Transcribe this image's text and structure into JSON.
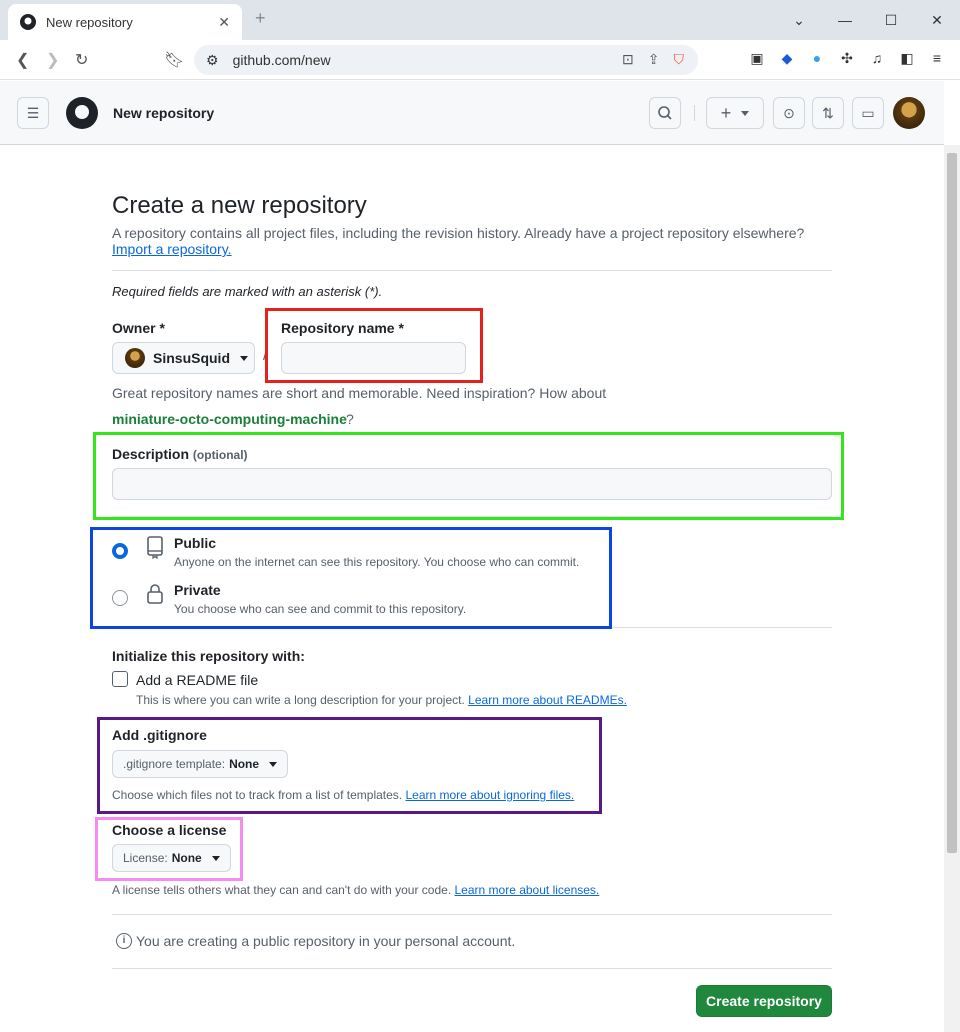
{
  "browser": {
    "tab_title": "New repository",
    "url": "github.com/new"
  },
  "header": {
    "title": "New repository",
    "new_button_label": "+"
  },
  "page": {
    "heading": "Create a new repository",
    "lede": "A repository contains all project files, including the revision history. Already have a project repository elsewhere?",
    "import_link": "Import a repository.",
    "required_note": "Required fields are marked with an asterisk (*)."
  },
  "owner": {
    "label": "Owner *",
    "value": "SinsuSquid"
  },
  "separator": "/",
  "repo_name": {
    "label": "Repository name *",
    "value": ""
  },
  "name_hint": "Great repository names are short and memorable. Need inspiration? How about",
  "suggestion": "miniature-octo-computing-machine",
  "suggestion_q": "?",
  "description": {
    "label": "Description",
    "optional": "(optional)",
    "value": ""
  },
  "visibility": {
    "public_title": "Public",
    "public_desc": "Anyone on the internet can see this repository. You choose who can commit.",
    "private_title": "Private",
    "private_desc": "You choose who can see and commit to this repository.",
    "selected": "public"
  },
  "init": {
    "heading": "Initialize this repository with:",
    "readme_label": "Add a README file",
    "readme_desc": "This is where you can write a long description for your project.",
    "readme_link": "Learn more about READMEs.",
    "readme_checked": false
  },
  "gitignore": {
    "heading": "Add .gitignore",
    "select_key": ".gitignore template:",
    "select_value": "None",
    "desc": "Choose which files not to track from a list of templates.",
    "link": "Learn more about ignoring files."
  },
  "license": {
    "heading": "Choose a license",
    "select_key": "License:",
    "select_value": "None",
    "desc": "A license tells others what they can and can't do with your code.",
    "link": "Learn more about licenses."
  },
  "notice": "You are creating a public repository in your personal account.",
  "submit_label": "Create repository",
  "annotation_colors": {
    "red": "#e8201c",
    "green": "#33e51a",
    "blue": "#0a47e0",
    "purple": "#5a1a86",
    "pink": "#f58cf0"
  },
  "colors": {
    "accent": "#0969da",
    "success": "#1f883d"
  }
}
